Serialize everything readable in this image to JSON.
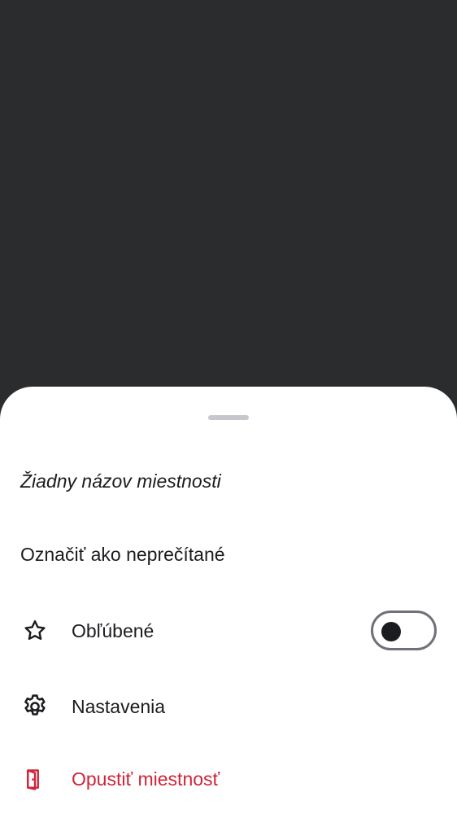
{
  "sheet": {
    "room_title": "Žiadny názov miestnosti",
    "items": [
      {
        "label": "Označiť ako neprečítané"
      },
      {
        "label": "Obľúbené",
        "icon": "star-outline-icon",
        "toggle_on": false
      },
      {
        "label": "Nastavenia",
        "icon": "gear-icon"
      },
      {
        "label": "Opustiť miestnosť",
        "icon": "door-leave-icon",
        "color": "#d1243a"
      }
    ]
  },
  "colors": {
    "scrim": "#2b2c2e",
    "sheet": "#ffffff",
    "text": "#1b1c1f",
    "destructive": "#d1243a"
  }
}
